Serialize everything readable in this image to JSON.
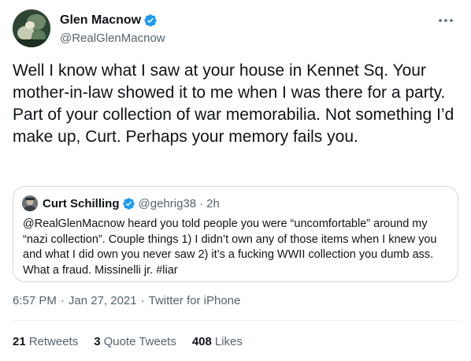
{
  "colors": {
    "verified_blue": "#1d9bf0",
    "text_primary": "#0f1419",
    "text_secondary": "#536471",
    "border": "#cfd9de"
  },
  "author": {
    "display_name": "Glen Macnow",
    "handle": "@RealGlenMacnow",
    "verified_icon": "verified-badge-icon"
  },
  "more_icon": "more-horizontal-icon",
  "tweet_text": "Well I know what I saw at your house in Kennet Sq. Your mother-in-law showed it to me when I was there for a party. Part of your collection of war memorabilia. Not something I’d make up, Curt. Perhaps your memory fails you.",
  "quote": {
    "display_name": "Curt Schilling",
    "handle": "@gehrig38",
    "separator": "·",
    "time": "2h",
    "text": "@RealGlenMacnow heard you told people you were “uncomfortable” around my “nazi collection”. Couple things 1) I didn’t own any of those items when I knew you and what I did own you never saw 2) it’s a fucking WWII collection you dumb ass. What a fraud. Missinelli jr. #liar"
  },
  "meta": {
    "time": "6:57 PM",
    "separator": "·",
    "date": "Jan 27, 2021",
    "source": "Twitter for iPhone"
  },
  "stats": {
    "retweets_count": "21",
    "retweets_label": "Retweets",
    "quotes_count": "3",
    "quotes_label": "Quote Tweets",
    "likes_count": "408",
    "likes_label": "Likes"
  }
}
